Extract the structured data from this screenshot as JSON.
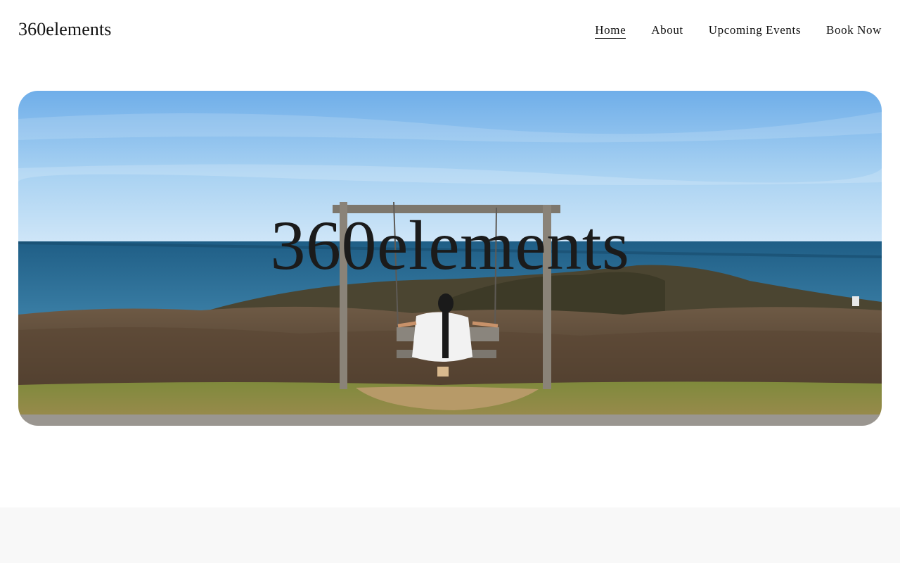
{
  "header": {
    "logo": "360elements",
    "nav": [
      {
        "label": "Home",
        "active": true
      },
      {
        "label": "About",
        "active": false
      },
      {
        "label": "Upcoming Events",
        "active": false
      },
      {
        "label": "Book Now",
        "active": false
      }
    ]
  },
  "hero": {
    "title": "360elements",
    "image_description_icon": "ocean-swing-photo"
  },
  "colors": {
    "text": "#111111",
    "sky": "#8cc2ee",
    "ocean": "#2b6a8f",
    "footer_bg": "#f8f8f8"
  }
}
